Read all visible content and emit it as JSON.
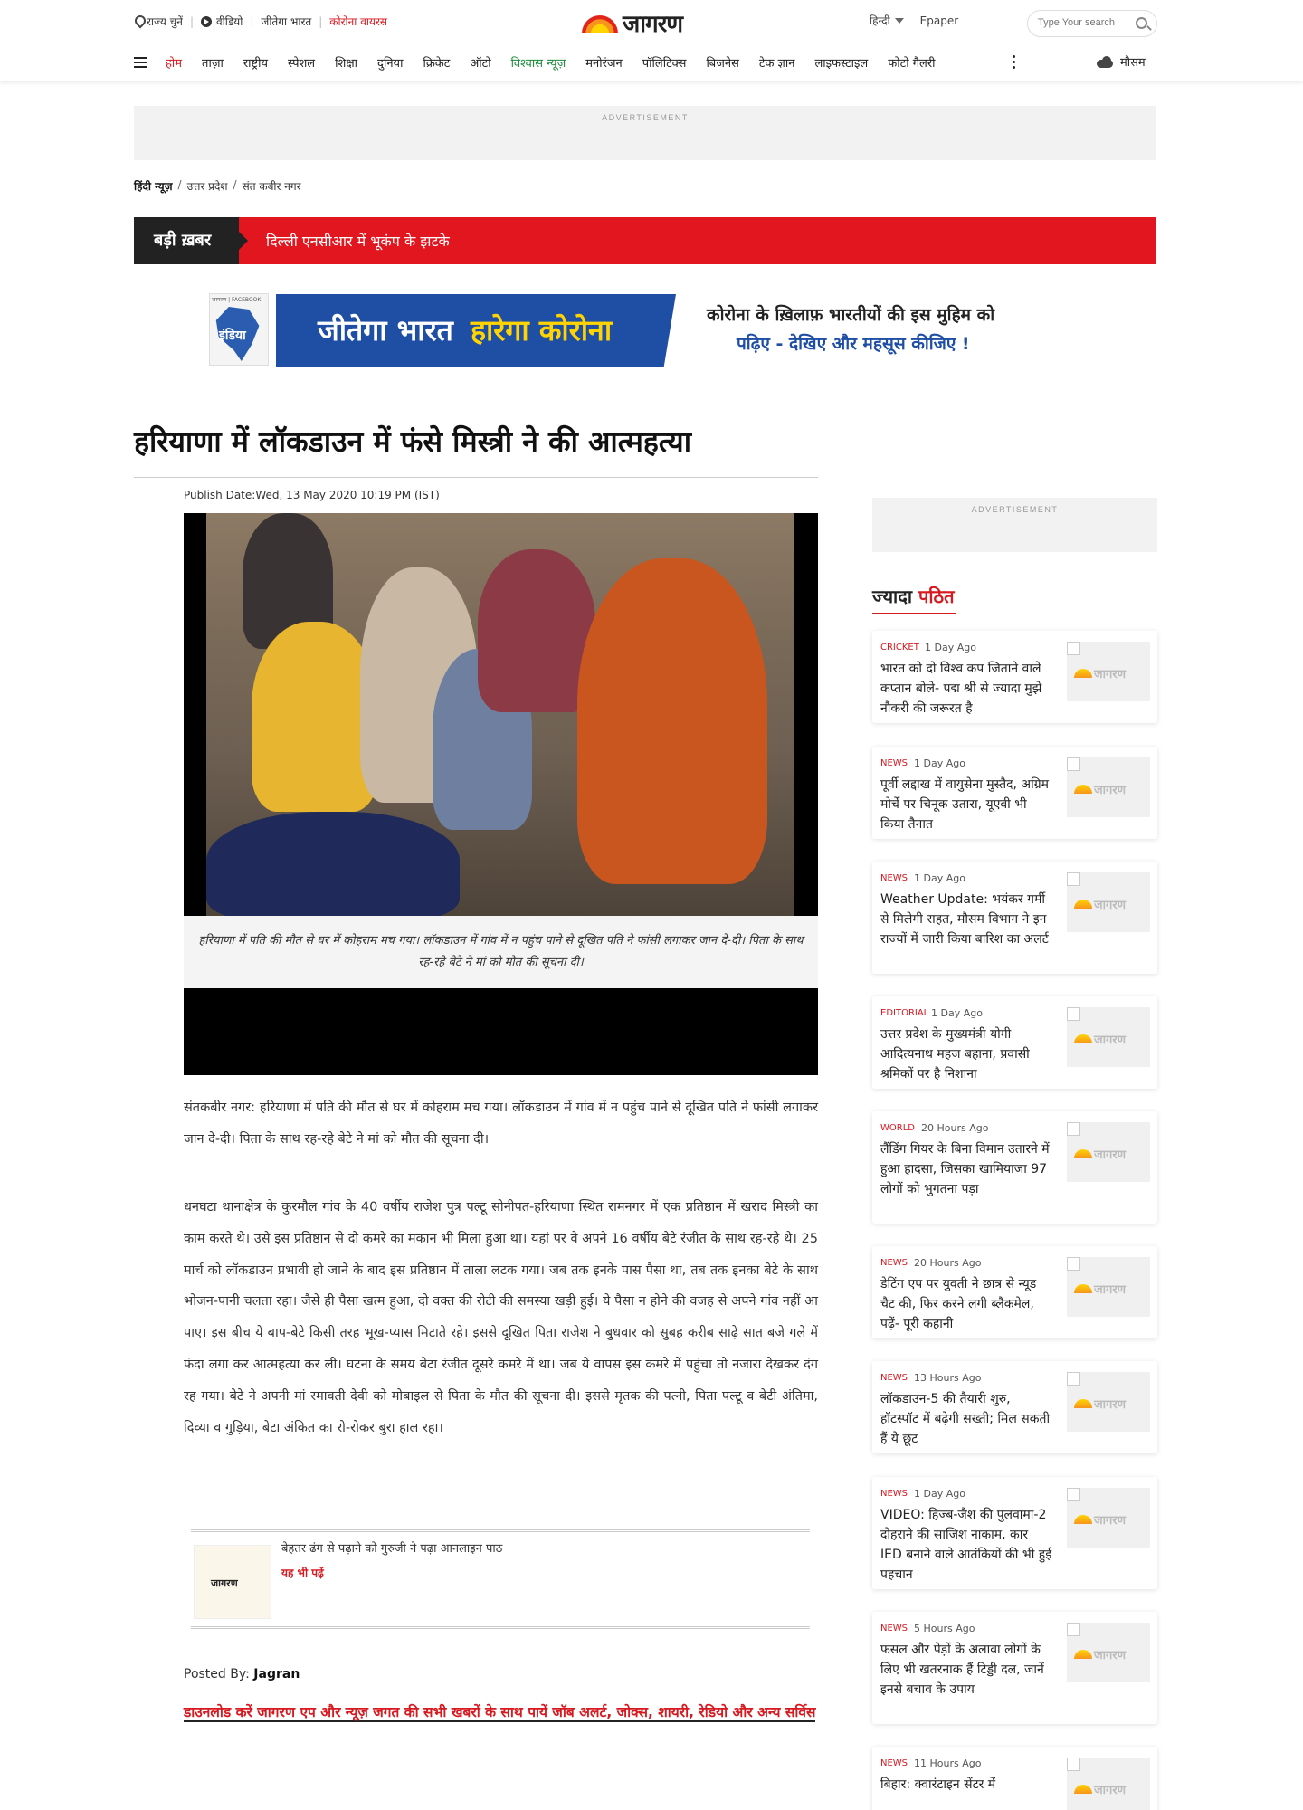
{
  "header": {
    "location_label": "राज्य चुनें",
    "video_label": "वीडियो",
    "jeetega_label": "जीतेगा भारत",
    "corona_label": "कोरोना वायरस",
    "logo_text": "जागरण",
    "language": "हिन्दी",
    "epaper": "Epaper",
    "search_placeholder": "Type Your search"
  },
  "nav": {
    "items": [
      "होम",
      "ताज़ा",
      "राष्ट्रीय",
      "स्पेशल",
      "शिक्षा",
      "दुनिया",
      "क्रिकेट",
      "ऑटो",
      "विश्वास न्यूज़",
      "मनोरंजन",
      "पॉलिटिक्स",
      "बिजनेस",
      "टेक ज्ञान",
      "लाइफस्टाइल",
      "फोटो गैलरी"
    ],
    "weather": "मौसम"
  },
  "ads": {
    "label": "ADVERTISEMENT"
  },
  "breadcrumb": {
    "home": "हिंदी न्यूज़",
    "state": "उत्तर प्रदेश",
    "city": "संत कबीर नगर"
  },
  "breaking": {
    "label": "बड़ी ख़बर",
    "text": "दिल्ली एनसीआर में भूकंप के झटके"
  },
  "promo": {
    "thumb_top": "जागरण | FACEBOOK",
    "thumb_title": "इंडिया",
    "main_white": "जीतेगा भारत",
    "main_yellow": "हारेगा कोरोना",
    "line1": "कोरोना के ख़िलाफ़ भारतीयों की इस मुहिम को",
    "line2": "पढ़िए - देखिए और महसूस कीजिए !"
  },
  "article": {
    "headline": "हरियाणा में लॉकडाउन में फंसे मिस्त्री ने की आत्महत्या",
    "publish_date": "Publish Date:Wed, 13 May 2020 10:19 PM (IST)",
    "caption": "हरियाणा में पति की मौत से घर में कोहराम मच गया। लॉकडाउन में गांव में न पहुंच पाने से दूखित पति ने फांसी लगाकर जान दे-दी। पिता के साथ रह-रहे बेटे ने मां को मौत की सूचना दी।",
    "para1": "संतकबीर नगर: हरियाणा में पति की मौत से घर में कोहराम मच गया। लॉकडाउन में गांव में न पहुंच पाने से दूखित पति ने फांसी लगाकर जान दे-दी। पिता के साथ रह-रहे बेटे ने मां को मौत की सूचना दी।",
    "para2": "धनघटा थानाक्षेत्र के कुरमौल गांव के 40 वर्षीय राजेश पुत्र पल्टू सोनीपत-हरियाणा स्थित रामनगर में एक प्रतिष्ठान में खराद मिस्त्री का काम करते थे। उसे इस प्रतिष्ठान से दो कमरे का मकान भी मिला हुआ था। यहां पर वे अपने 16 वर्षीय बेटे रंजीत के साथ रह-रहे थे। 25 मार्च को लॉकडाउन प्रभावी हो जाने के बाद इस प्रतिष्ठान में ताला लटक गया। जब तक इनके पास पैसा था, तब तक इनका बेटे के साथ भोजन-पानी चलता रहा। जैसे ही पैसा खत्म हुआ, दो वक्त की रोटी की समस्या खड़ी हुई। ये पैसा न होने की वजह से अपने गांव नहीं आ पाए। इस बीच ये बाप-बेटे किसी तरह भूख-प्यास मिटाते रहे। इससे दूखित पिता राजेश ने बुधवार को सुबह करीब साढ़े सात बजे गले में फंदा लगा कर आत्महत्या कर ली। घटना के समय बेटा रंजीत दूसरे कमरे में था। जब ये वापस इस कमरे में पहुंचा तो नजारा देखकर दंग रह गया। बेटे ने अपनी मां रमावती देवी को मोबाइल से पिता के मौत की सूचना दी। इससे मृतक की पत्नी, पिता पल्टू व बेटी अंतिमा, दिव्या व गुड़िया, बेटा अंकित का रो-रोकर बुरा हाल रहा।",
    "related_title": "बेहतर ढंग से पढ़ाने को गुरुजी ने पढ़ा आनलाइन पाठ",
    "related_link": "यह भी पढ़ें",
    "related_logo": "जागरण",
    "posted_label": "Posted By:",
    "posted_by": "Jagran",
    "download": "डाउनलोड करें जागरण एप और न्यूज़ जगत की सभी खबरों के साथ पायें जॉब अलर्ट, जोक्स, शायरी, रेडियो और अन्य सर्विस"
  },
  "share_icons": [
    "facebook-icon",
    "twitter-icon",
    "whatsapp-icon",
    "email-icon",
    "tag-icon"
  ],
  "sidebar": {
    "heading_black": "ज्यादा",
    "heading_red": "पठित",
    "thumb_logo": "जागरण",
    "cards": [
      {
        "cat": "CRICKET",
        "time": "1 Day Ago",
        "title": "भारत को दो विश्व कप जिताने वाले कप्तान बोले- पद्म श्री से ज्यादा मुझे नौकरी की जरूरत है"
      },
      {
        "cat": "NEWS",
        "time": "1 Day Ago",
        "title": "पूर्वी लद्दाख में वायुसेना मुस्तैद, अग्रिम मोर्चे पर चिनूक उतारा, यूएवी भी किया तैनात"
      },
      {
        "cat": "NEWS",
        "time": "1 Day Ago",
        "title": "Weather Update: भयंकर गर्मी से मिलेगी राहत, मौसम विभाग ने इन राज्यों में जारी किया बारिश का अलर्ट"
      },
      {
        "cat": "EDITORIAL",
        "time": "1 Day Ago",
        "title": "उत्तर प्रदेश के मुख्यमंत्री योगी आदित्यनाथ महज बहाना, प्रवासी श्रमिकों पर है निशाना"
      },
      {
        "cat": "WORLD",
        "time": "20 Hours Ago",
        "title": "लैंडिंग गियर के बिना विमान उतारने में हुआ हादसा, जिसका खामियाजा 97 लोगों को भुगतना पड़ा"
      },
      {
        "cat": "NEWS",
        "time": "20 Hours Ago",
        "title": "डेटिंग एप पर युवती ने छात्र से न्यूड चैट की, फिर करने लगी ब्लैकमेल, पढ़ें- पूरी कहानी"
      },
      {
        "cat": "NEWS",
        "time": "13 Hours Ago",
        "title": "लॉकडाउन-5 की तैयारी शुरु, हॉटस्पॉट में बढ़ेगी सख्ती; मिल सकती हैं ये छूट"
      },
      {
        "cat": "NEWS",
        "time": "1 Day Ago",
        "title": "VIDEO: हिज्ब-जैश की पुलवामा-2 दोहराने की साजिश नाकाम, कार IED बनाने वाले आतंकियों की भी हुई पहचान"
      },
      {
        "cat": "NEWS",
        "time": "5 Hours Ago",
        "title": "फसल और पेड़ों के अलावा लोगों के लिए भी खतरनाक हैं टिड्डी दल, जानें इनसे बचाव के उपाय"
      },
      {
        "cat": "NEWS",
        "time": "11 Hours Ago",
        "title": "बिहार: क्वारंटाइन सेंटर में"
      }
    ]
  }
}
